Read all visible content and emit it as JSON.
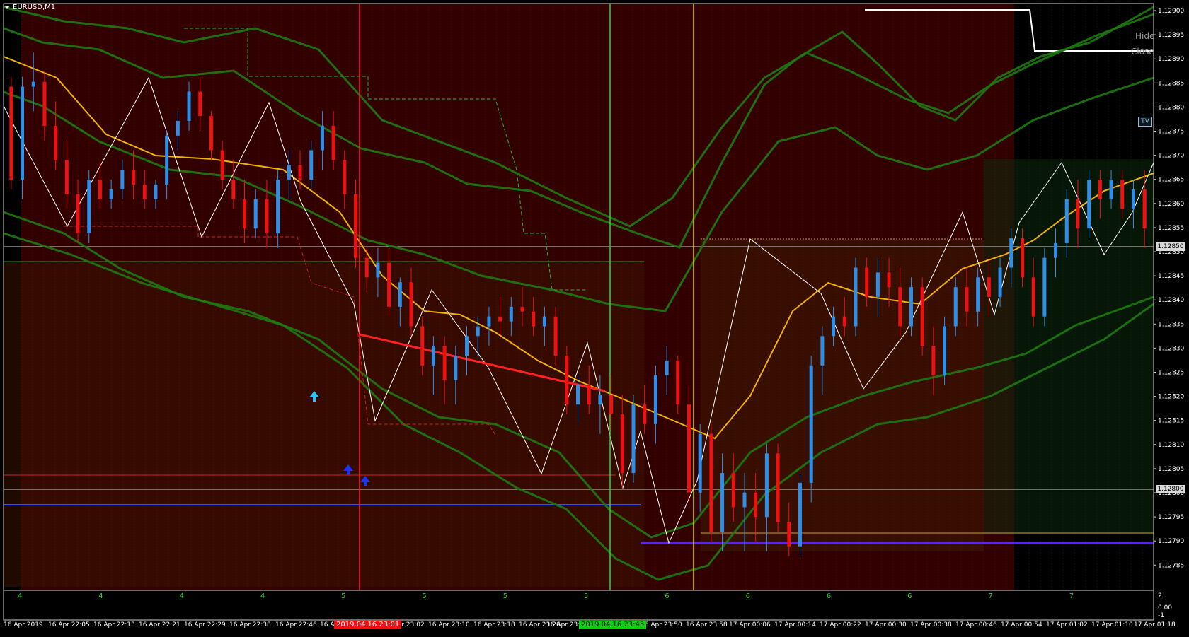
{
  "window": {
    "symbol": "EURUSD,M1",
    "hide_label": "Hide",
    "close_label": "Close",
    "tv_label": "TV"
  },
  "colors": {
    "background": "#330000",
    "bull_candle": "#2f8fe8",
    "bear_candle": "#ee1111",
    "ma_line": "#f2b200",
    "channel": "#1e7a10",
    "vline_red": "#ff2222",
    "vline_green": "#22dd22",
    "vline_yellow": "#e8d000"
  },
  "price_axis": {
    "labels": [
      "1.12900",
      "1.12895",
      "1.12890",
      "1.12885",
      "1.12880",
      "1.12875",
      "1.12870",
      "1.12865",
      "1.12860",
      "1.12855",
      "1.12850",
      "1.12845",
      "1.12840",
      "1.12835",
      "1.12830",
      "1.12825",
      "1.12820",
      "1.12815",
      "1.12810",
      "1.12805",
      "1.12800",
      "1.12795",
      "1.12790",
      "1.12785"
    ],
    "tag_upper": "1.12850",
    "tag_lower": "1.12800"
  },
  "time_axis": {
    "labels": [
      "16 Apr 2019",
      "16 Apr 22:05",
      "16 Apr 22:13",
      "16 Apr 22:21",
      "16 Apr 22:29",
      "16 Apr 22:38",
      "16 Apr 22:46",
      "16 Apr 23:02",
      "16 Apr 23:10",
      "16 Apr 23:18",
      "16 Apr 23:26",
      "16 Apr 23:50",
      "16 Apr 23:58",
      "17 Apr 00:06",
      "17 Apr 00:14",
      "17 Apr 00:22",
      "17 Apr 00:30",
      "17 Apr 00:38",
      "17 Apr 00:46",
      "17 Apr 00:54",
      "17 Apr 01:02",
      "17 Apr 01:10",
      "17 Apr 01:18"
    ],
    "partial_left": "16 A",
    "partial_mid": "16 Apr 23:3",
    "marker_red": "2019.04.16 23:01",
    "marker_green": "2019.04.16 23:45"
  },
  "sub_window": {
    "digits": [
      "4",
      "4",
      "4",
      "4",
      "5",
      "5",
      "5",
      "5",
      "6",
      "6",
      "6",
      "6",
      "7",
      "7"
    ],
    "scale_top": "2",
    "scale_mid": "0.00",
    "scale_bottom": "-1"
  },
  "chart_data": {
    "type": "candlestick",
    "symbol": "EURUSD",
    "timeframe": "M1",
    "ylim": [
      1.12782,
      1.12902
    ],
    "ohlc": [
      [
        1.12885,
        1.12887,
        1.12864,
        1.12866
      ],
      [
        1.12866,
        1.12887,
        1.12862,
        1.12885
      ],
      [
        1.12885,
        1.12892,
        1.1288,
        1.12886
      ],
      [
        1.12886,
        1.12888,
        1.12874,
        1.12877
      ],
      [
        1.12877,
        1.12882,
        1.12868,
        1.1287
      ],
      [
        1.1287,
        1.12874,
        1.1286,
        1.12863
      ],
      [
        1.12863,
        1.12866,
        1.12853,
        1.12855
      ],
      [
        1.12855,
        1.12868,
        1.12853,
        1.12866
      ],
      [
        1.12866,
        1.1287,
        1.1286,
        1.12862
      ],
      [
        1.12862,
        1.12866,
        1.1286,
        1.12864
      ],
      [
        1.12864,
        1.1287,
        1.12862,
        1.12868
      ],
      [
        1.12868,
        1.12872,
        1.12862,
        1.12865
      ],
      [
        1.12865,
        1.12868,
        1.1286,
        1.12862
      ],
      [
        1.12862,
        1.12866,
        1.1286,
        1.12865
      ],
      [
        1.12865,
        1.12876,
        1.12862,
        1.12875
      ],
      [
        1.12875,
        1.1288,
        1.12872,
        1.12878
      ],
      [
        1.12878,
        1.12886,
        1.12876,
        1.12884
      ],
      [
        1.12884,
        1.12887,
        1.12876,
        1.12879
      ],
      [
        1.12879,
        1.1288,
        1.1287,
        1.12872
      ],
      [
        1.12872,
        1.12874,
        1.12864,
        1.12866
      ],
      [
        1.12866,
        1.1287,
        1.1286,
        1.12862
      ],
      [
        1.12862,
        1.12866,
        1.12853,
        1.12856
      ],
      [
        1.12856,
        1.12864,
        1.12854,
        1.12862
      ],
      [
        1.12862,
        1.12866,
        1.12852,
        1.12855
      ],
      [
        1.12855,
        1.12868,
        1.12852,
        1.12866
      ],
      [
        1.12866,
        1.12872,
        1.12862,
        1.12869
      ],
      [
        1.12869,
        1.12872,
        1.12864,
        1.12866
      ],
      [
        1.12866,
        1.12874,
        1.12864,
        1.12872
      ],
      [
        1.12872,
        1.1288,
        1.12868,
        1.12877
      ],
      [
        1.12877,
        1.1288,
        1.12868,
        1.1287
      ],
      [
        1.1287,
        1.12872,
        1.1286,
        1.12863
      ],
      [
        1.12863,
        1.12866,
        1.12848,
        1.1285
      ],
      [
        1.1285,
        1.12852,
        1.12843,
        1.12846
      ],
      [
        1.12846,
        1.12852,
        1.12842,
        1.12849
      ],
      [
        1.12849,
        1.12852,
        1.12838,
        1.1284
      ],
      [
        1.1284,
        1.12846,
        1.12836,
        1.12845
      ],
      [
        1.12845,
        1.12848,
        1.12834,
        1.12836
      ],
      [
        1.12836,
        1.12838,
        1.12826,
        1.12828
      ],
      [
        1.12828,
        1.12834,
        1.12822,
        1.12832
      ],
      [
        1.12832,
        1.12834,
        1.1282,
        1.12825
      ],
      [
        1.12825,
        1.12832,
        1.1282,
        1.1283
      ],
      [
        1.1283,
        1.12836,
        1.12826,
        1.12834
      ],
      [
        1.12834,
        1.12838,
        1.1283,
        1.12836
      ],
      [
        1.12836,
        1.1284,
        1.12832,
        1.12838
      ],
      [
        1.12838,
        1.12842,
        1.12834,
        1.12837
      ],
      [
        1.12837,
        1.12842,
        1.12834,
        1.1284
      ],
      [
        1.1284,
        1.12844,
        1.12836,
        1.12839
      ],
      [
        1.12839,
        1.12842,
        1.12834,
        1.12836
      ],
      [
        1.12836,
        1.1284,
        1.12832,
        1.12838
      ],
      [
        1.12838,
        1.1284,
        1.12828,
        1.1283
      ],
      [
        1.1283,
        1.12832,
        1.12818,
        1.1282
      ],
      [
        1.1282,
        1.12826,
        1.12816,
        1.12824
      ],
      [
        1.12824,
        1.12828,
        1.12818,
        1.1282
      ],
      [
        1.1282,
        1.12826,
        1.12814,
        1.12822
      ],
      [
        1.12822,
        1.12826,
        1.12815,
        1.12818
      ],
      [
        1.12818,
        1.12822,
        1.12803,
        1.12806
      ],
      [
        1.12806,
        1.12822,
        1.12804,
        1.1282
      ],
      [
        1.1282,
        1.12824,
        1.12814,
        1.12816
      ],
      [
        1.12816,
        1.12828,
        1.12812,
        1.12826
      ],
      [
        1.12826,
        1.12832,
        1.12822,
        1.12829
      ],
      [
        1.12829,
        1.1283,
        1.12818,
        1.1282
      ],
      [
        1.1282,
        1.12824,
        1.128,
        1.12802
      ],
      [
        1.12802,
        1.12816,
        1.12798,
        1.12814
      ],
      [
        1.12814,
        1.12816,
        1.12792,
        1.12794
      ],
      [
        1.12794,
        1.1281,
        1.1279,
        1.12806
      ],
      [
        1.12806,
        1.1281,
        1.12796,
        1.12799
      ],
      [
        1.12799,
        1.12806,
        1.1279,
        1.12802
      ],
      [
        1.12802,
        1.12806,
        1.12792,
        1.12797
      ],
      [
        1.12797,
        1.12812,
        1.1279,
        1.1281
      ],
      [
        1.1281,
        1.12812,
        1.12794,
        1.12796
      ],
      [
        1.12796,
        1.128,
        1.12789,
        1.12791
      ],
      [
        1.12791,
        1.12806,
        1.12789,
        1.12804
      ],
      [
        1.12804,
        1.1283,
        1.128,
        1.12828
      ],
      [
        1.12828,
        1.12836,
        1.12822,
        1.12834
      ],
      [
        1.12834,
        1.1284,
        1.12832,
        1.12838
      ],
      [
        1.12838,
        1.12842,
        1.12834,
        1.12836
      ],
      [
        1.12836,
        1.1285,
        1.12834,
        1.12848
      ],
      [
        1.12848,
        1.1285,
        1.1284,
        1.12842
      ],
      [
        1.12842,
        1.1285,
        1.12838,
        1.12847
      ],
      [
        1.12847,
        1.1285,
        1.1284,
        1.12844
      ],
      [
        1.12844,
        1.12848,
        1.12834,
        1.12836
      ],
      [
        1.12836,
        1.12846,
        1.12834,
        1.12844
      ],
      [
        1.12844,
        1.12846,
        1.1283,
        1.12832
      ],
      [
        1.12832,
        1.12836,
        1.12822,
        1.12826
      ],
      [
        1.12826,
        1.12838,
        1.12824,
        1.12836
      ],
      [
        1.12836,
        1.12846,
        1.12834,
        1.12844
      ],
      [
        1.12844,
        1.12848,
        1.12836,
        1.12839
      ],
      [
        1.12839,
        1.12848,
        1.12836,
        1.12846
      ],
      [
        1.12846,
        1.1285,
        1.12838,
        1.12842
      ],
      [
        1.12842,
        1.1285,
        1.1284,
        1.12848
      ],
      [
        1.12848,
        1.12856,
        1.12844,
        1.12854
      ],
      [
        1.12854,
        1.12856,
        1.12844,
        1.12846
      ],
      [
        1.12846,
        1.1285,
        1.12836,
        1.12838
      ],
      [
        1.12838,
        1.12852,
        1.12836,
        1.1285
      ],
      [
        1.1285,
        1.12856,
        1.12846,
        1.12853
      ],
      [
        1.12853,
        1.12864,
        1.1285,
        1.12862
      ],
      [
        1.12862,
        1.12866,
        1.12852,
        1.12856
      ],
      [
        1.12856,
        1.12868,
        1.12854,
        1.12866
      ],
      [
        1.12866,
        1.12868,
        1.12858,
        1.12862
      ],
      [
        1.12862,
        1.12868,
        1.1286,
        1.12866
      ],
      [
        1.12866,
        1.12868,
        1.12858,
        1.1286
      ],
      [
        1.1286,
        1.12866,
        1.12856,
        1.12864
      ],
      [
        1.12864,
        1.12868,
        1.12852,
        1.12856
      ]
    ]
  }
}
